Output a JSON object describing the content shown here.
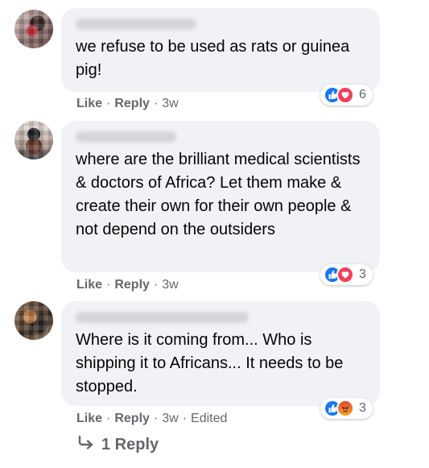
{
  "comments": [
    {
      "text": "we refuse to be used as rats or guinea pig!",
      "actions": {
        "like": "Like",
        "reply": "Reply",
        "time": "3w"
      },
      "reactions": {
        "icons": [
          "like-icon",
          "love-icon"
        ],
        "count": "6"
      }
    },
    {
      "text": "where are the brilliant medical scientists & doctors of Africa? Let them make & create their own for their own people & not depend on the outsiders",
      "actions": {
        "like": "Like",
        "reply": "Reply",
        "time": "3w"
      },
      "reactions": {
        "icons": [
          "like-icon",
          "love-icon"
        ],
        "count": "3"
      }
    },
    {
      "text": "Where is it coming from... Who is shipping it to Africans... It needs to be stopped.",
      "actions": {
        "like": "Like",
        "reply": "Reply",
        "time": "3w",
        "edited": "Edited"
      },
      "reactions": {
        "icons": [
          "like-icon",
          "angry-icon"
        ],
        "count": "3"
      }
    }
  ],
  "replies_link": "1 Reply",
  "colors": {
    "bubble": "#f0f2f5",
    "meta_text": "#65676b",
    "like_blue": "#1877f2",
    "love_red": "#f33e58"
  }
}
